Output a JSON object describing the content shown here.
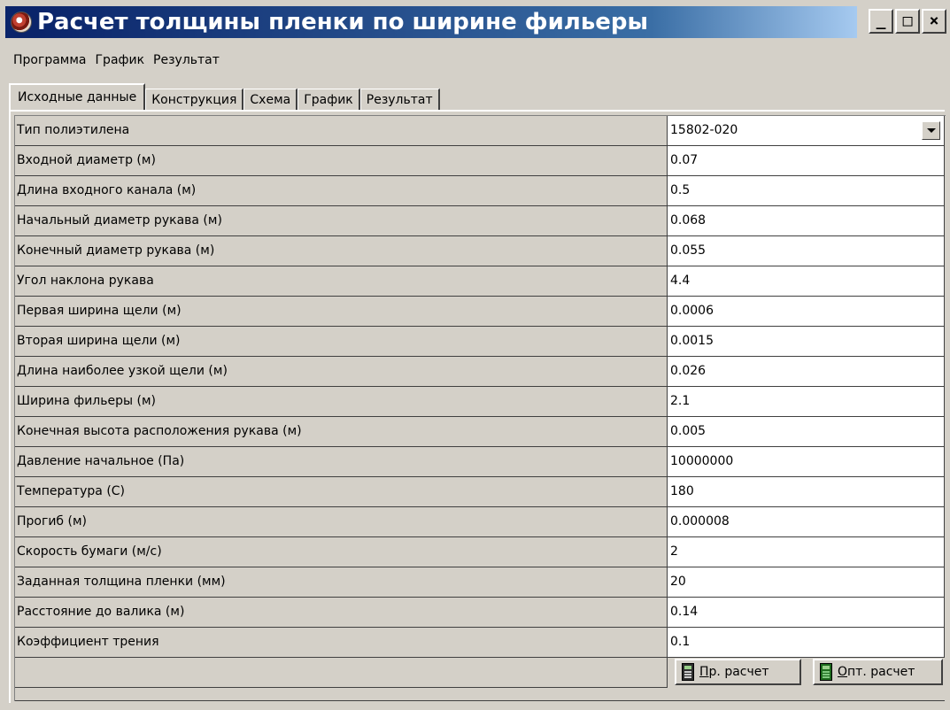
{
  "window": {
    "title": "Расчет толщины пленки по ширине фильеры",
    "minimize_glyph": "_",
    "maximize_glyph": "□",
    "close_glyph": "×"
  },
  "menu": [
    "Программа",
    "График",
    "Результат"
  ],
  "tabs": [
    {
      "label": "Исходные данные",
      "active": true
    },
    {
      "label": "Конструкция",
      "active": false
    },
    {
      "label": "Схема",
      "active": false
    },
    {
      "label": "График",
      "active": false
    },
    {
      "label": "Результат",
      "active": false
    }
  ],
  "params": [
    {
      "label": "Тип полиэтилена",
      "value": "15802-020",
      "kind": "dropdown"
    },
    {
      "label": "Входной диаметр (м)",
      "value": "0.07"
    },
    {
      "label": "Длина входного канала (м)",
      "value": "0.5"
    },
    {
      "label": "Начальный диаметр рукава (м)",
      "value": "0.068"
    },
    {
      "label": "Конечный диаметр рукава (м)",
      "value": "0.055"
    },
    {
      "label": "Угол наклона рукава",
      "value": "4.4"
    },
    {
      "label": "Первая ширина щели (м)",
      "value": "0.0006"
    },
    {
      "label": "Вторая ширина щели (м)",
      "value": "0.0015"
    },
    {
      "label": "Длина наиболее узкой щели (м)",
      "value": "0.026"
    },
    {
      "label": "Ширина фильеры (м)",
      "value": "2.1"
    },
    {
      "label": "Конечная высота расположения рукава (м)",
      "value": "0.005"
    },
    {
      "label": "Давление начальное (Па)",
      "value": "10000000"
    },
    {
      "label": "Температура (C)",
      "value": "180"
    },
    {
      "label": "Прогиб (м)",
      "value": "0.000008"
    },
    {
      "label": "Скорость бумаги (м/с)",
      "value": "2"
    },
    {
      "label": "Заданная толщина пленки (мм)",
      "value": "20"
    },
    {
      "label": "Расстояние до валика (м)",
      "value": "0.14"
    },
    {
      "label": "Коэффициент трения",
      "value": "0.1"
    }
  ],
  "actions": {
    "calc": {
      "label_underlined": "П",
      "label_rest": "р. расчет",
      "icon": "calculator-icon"
    },
    "opt_calc": {
      "label_underlined": "О",
      "label_rest": "пт. расчет",
      "icon": "calculator-green-icon"
    }
  }
}
